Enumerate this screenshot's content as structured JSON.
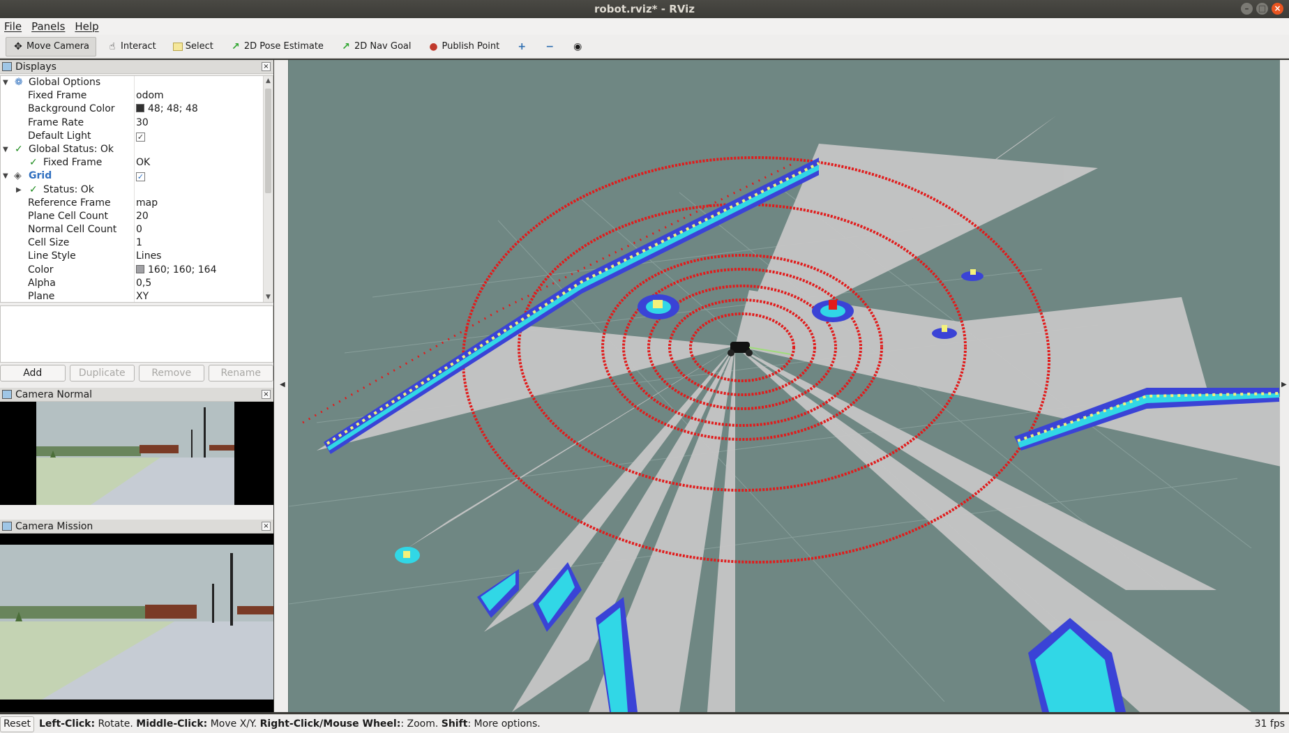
{
  "window": {
    "title": "robot.rviz* - RViz"
  },
  "menu": [
    "File",
    "Panels",
    "Help"
  ],
  "toolbar": {
    "move_camera": "Move Camera",
    "interact": "Interact",
    "select": "Select",
    "pose_estimate": "2D Pose Estimate",
    "nav_goal": "2D Nav Goal",
    "publish_point": "Publish Point"
  },
  "displays": {
    "title": "Displays",
    "global_options": "Global Options",
    "fixed_frame_label": "Fixed Frame",
    "fixed_frame_value": "odom",
    "background_color_label": "Background Color",
    "background_color_value": "48; 48; 48",
    "frame_rate_label": "Frame Rate",
    "frame_rate_value": "30",
    "default_light_label": "Default Light",
    "global_status": "Global Status: Ok",
    "gs_fixed_frame_label": "Fixed Frame",
    "gs_fixed_frame_value": "OK",
    "grid_label": "Grid",
    "status_ok": "Status: Ok",
    "reference_frame_label": "Reference Frame",
    "reference_frame_value": "map",
    "plane_cell_count_label": "Plane Cell Count",
    "plane_cell_count_value": "20",
    "normal_cell_count_label": "Normal Cell Count",
    "normal_cell_count_value": "0",
    "cell_size_label": "Cell Size",
    "cell_size_value": "1",
    "line_style_label": "Line Style",
    "line_style_value": "Lines",
    "color_label": "Color",
    "color_value": "160; 160; 164",
    "alpha_label": "Alpha",
    "alpha_value": "0,5",
    "plane_label": "Plane",
    "plane_value": "XY"
  },
  "buttons": {
    "add": "Add",
    "duplicate": "Duplicate",
    "remove": "Remove",
    "rename": "Rename"
  },
  "cameras": {
    "normal": "Camera Normal",
    "mission": "Camera Mission"
  },
  "status": {
    "reset": "Reset",
    "h1b": "Left-Click:",
    "h1": " Rotate. ",
    "h2b": "Middle-Click:",
    "h2": " Move X/Y. ",
    "h3b": "Right-Click/Mouse Wheel:",
    "h3": ": Zoom. ",
    "h4b": "Shift",
    "h4": ": More options.",
    "fps": "31 fps"
  },
  "colors": {
    "viewport_bg": "#6f8783",
    "scan_red": "#e11b1b",
    "ground": "#c6c6c6"
  }
}
